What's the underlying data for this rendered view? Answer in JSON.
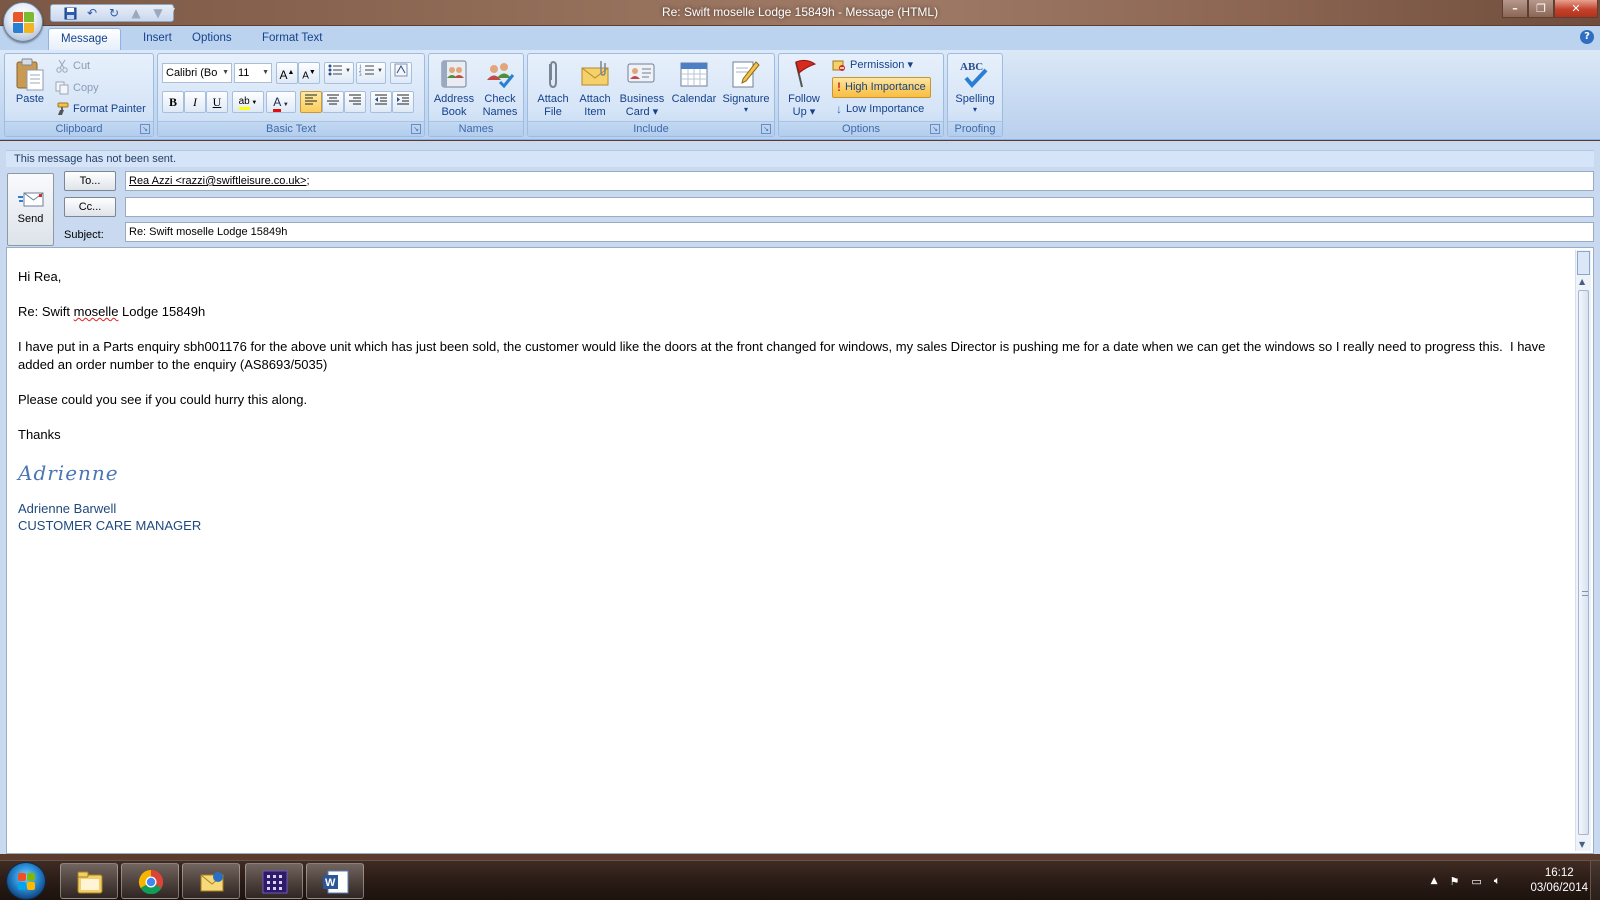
{
  "window": {
    "title": "Re: Swift moselle Lodge 15849h - Message (HTML)"
  },
  "quick_access": {
    "icons": [
      "save-icon",
      "undo-icon",
      "redo-icon",
      "previous-icon",
      "next-icon"
    ],
    "more": "▾"
  },
  "ribbon_tabs": [
    {
      "label": "Message",
      "active": true
    },
    {
      "label": "Insert",
      "active": false
    },
    {
      "label": "Options",
      "active": false
    },
    {
      "label": "Format Text",
      "active": false
    }
  ],
  "clipboard": {
    "label": "Clipboard",
    "paste": "Paste",
    "cut": "Cut",
    "copy": "Copy",
    "format_painter": "Format Painter"
  },
  "basic_text": {
    "label": "Basic Text",
    "font_name": "Calibri (Bo",
    "font_size": "11",
    "bold": "B",
    "italic": "I",
    "underline": "U",
    "highlight": "ab",
    "font_color": "A"
  },
  "names": {
    "label": "Names",
    "address_book_1": "Address",
    "address_book_2": "Book",
    "check_names_1": "Check",
    "check_names_2": "Names"
  },
  "include": {
    "label": "Include",
    "attach_file_1": "Attach",
    "attach_file_2": "File",
    "attach_item_1": "Attach",
    "attach_item_2": "Item",
    "business_card_1": "Business",
    "business_card_2": "Card ▾",
    "calendar": "Calendar",
    "signature": "Signature",
    "signature_dd": "▾"
  },
  "options": {
    "label": "Options",
    "follow_up_1": "Follow",
    "follow_up_2": "Up ▾",
    "permission": "Permission ▾",
    "high_importance": "High Importance",
    "low_importance": "Low Importance"
  },
  "proofing": {
    "label": "Proofing",
    "spelling": "Spelling",
    "spelling_dd": "▾",
    "abc": "ABC"
  },
  "message": {
    "infobar": "This message has not been sent.",
    "send": "Send",
    "to_button": "To...",
    "cc_button": "Cc...",
    "subject_label": "Subject:",
    "to_value": "Rea Azzi <razzi@swiftleisure.co.uk>",
    "to_suffix": ";",
    "cc_value": "",
    "subject_value": "Re: Swift moselle Lodge 15849h"
  },
  "body": {
    "greeting": "Hi Rea,",
    "re_prefix": "Re: Swift ",
    "re_word": "moselle",
    "re_suffix": " Lodge 15849h",
    "para1": "I have put in a Parts enquiry sbh001176 for the above unit which has just been sold, the customer would like the doors at the front changed for windows, my sales Director is pushing me for a date when we can get the windows so I really need to progress this.  I have added an order number to the enquiry (AS8693/5035)",
    "para2": "Please could you see if you could hurry this along.",
    "thanks": "Thanks",
    "signature_script": "Adrienne",
    "signature_name": "Adrienne Barwell",
    "signature_title": "CUSTOMER CARE MANAGER"
  },
  "taskbar": {
    "apps": [
      "windows-explorer-icon",
      "chrome-icon",
      "outlook-icon",
      "app-grid-icon",
      "word-icon"
    ],
    "time": "16:12",
    "date": "03/06/2014"
  }
}
